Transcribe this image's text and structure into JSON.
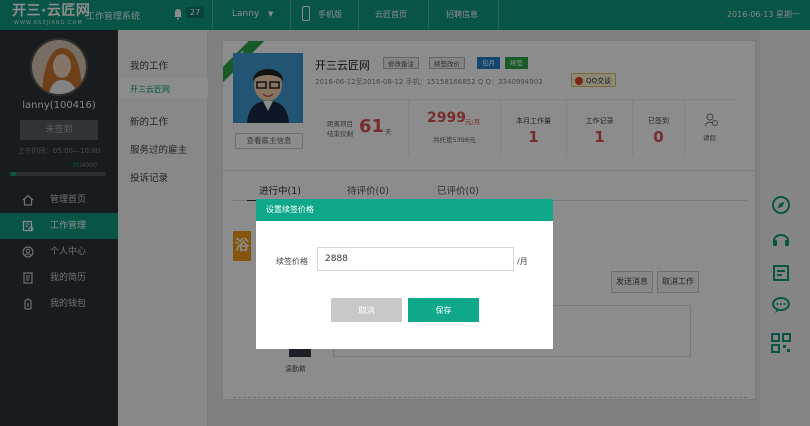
{
  "topbar": {
    "logo": "开三·云匠网",
    "logo_sub": "WWW.KS3JIANG.COM",
    "system_name": "工作管理系统",
    "notification_count": "27",
    "user": "Lanny",
    "mobile": "手机版",
    "nav": [
      "云匠首页",
      "招聘信息"
    ],
    "date": "2016-06-13 星期一"
  },
  "sidebar": {
    "username": "lanny(100416)",
    "sign_button": "未签到",
    "work_time": "上午时间：05:00—10:00",
    "progress_current": "35",
    "progress_total": "/4000",
    "progress_fraction": 0.0088,
    "menu": [
      {
        "label": "管理首页",
        "icon": "home-icon"
      },
      {
        "label": "工作管理",
        "icon": "work-icon",
        "active": true
      },
      {
        "label": "个人中心",
        "icon": "user-icon"
      },
      {
        "label": "我的简历",
        "icon": "resume-icon"
      },
      {
        "label": "我的钱包",
        "icon": "wallet-icon"
      }
    ]
  },
  "submenu": {
    "items": [
      "我的工作",
      "开三云匠网",
      "新的工作",
      "服务过的雇主",
      "投诉记录"
    ]
  },
  "card": {
    "ribbon": "正常",
    "company": "开三云匠网",
    "tag_buttons": [
      "修改备注",
      "续签改价"
    ],
    "tag_blue": "包月",
    "tag_green": "续签",
    "info": "2016-06-12至2016-08-12     手机：15158166852     Q  Q：3340994903",
    "qq_button": "QQ交谈",
    "view_employer": "查看雇主信息",
    "stat_end_l1": "距离项目",
    "stat_end_l2": "结束仅剩",
    "stat_end_days": "61",
    "stat_end_unit": "天",
    "stat_price": "2999",
    "stat_price_unit": "元/月",
    "stat_price_total": "共托管5398元",
    "workload_title": "本月工作量",
    "workload_value": "1",
    "record_title": "工作记录",
    "record_value": "1",
    "signed_title": "已签到",
    "signed_value": "0",
    "leave_label": "请假"
  },
  "tabs": [
    "进行中(1)",
    "待评价(0)",
    "已评价(0)"
  ],
  "actions": {
    "send_message": "发送消息",
    "cancel_work": "取消工作",
    "thumb_char": "浴",
    "person_name": "温勤斯"
  },
  "modal": {
    "title": "设置续签价格",
    "field_label": "续签价格",
    "field_value": "2888",
    "unit": "/月",
    "cancel": "取消",
    "save": "保存"
  }
}
